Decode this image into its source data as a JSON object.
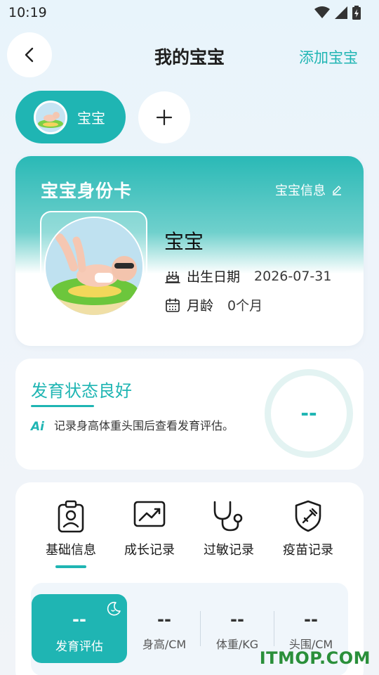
{
  "status_bar": {
    "time": "10:19"
  },
  "header": {
    "title": "我的宝宝",
    "add_baby": "添加宝宝"
  },
  "baby_switcher": {
    "selected_label": "宝宝"
  },
  "id_card": {
    "title": "宝宝身份卡",
    "info_link": "宝宝信息",
    "name": "宝宝",
    "birth_label": "出生日期",
    "birth_value": "2026-07-31",
    "age_label": "月龄",
    "age_value": "0个月"
  },
  "development": {
    "title": "发育状态良好",
    "ai_tag": "Ai",
    "description": "记录身高体重头围后查看发育评估。",
    "score": "--"
  },
  "records": {
    "tabs": [
      {
        "label": "基础信息",
        "icon": "id-badge-icon"
      },
      {
        "label": "成长记录",
        "icon": "growth-chart-icon"
      },
      {
        "label": "过敏记录",
        "icon": "stethoscope-icon"
      },
      {
        "label": "疫苗记录",
        "icon": "vaccine-shield-icon"
      }
    ],
    "stats": [
      {
        "value": "--",
        "label": "发育评估"
      },
      {
        "value": "--",
        "label": "身高/CM"
      },
      {
        "value": "--",
        "label": "体重/KG"
      },
      {
        "value": "--",
        "label": "头围/CM"
      }
    ]
  },
  "watermark": "ITMOP.COM",
  "colors": {
    "accent": "#1fb5b3",
    "background": "#eef4fa"
  }
}
